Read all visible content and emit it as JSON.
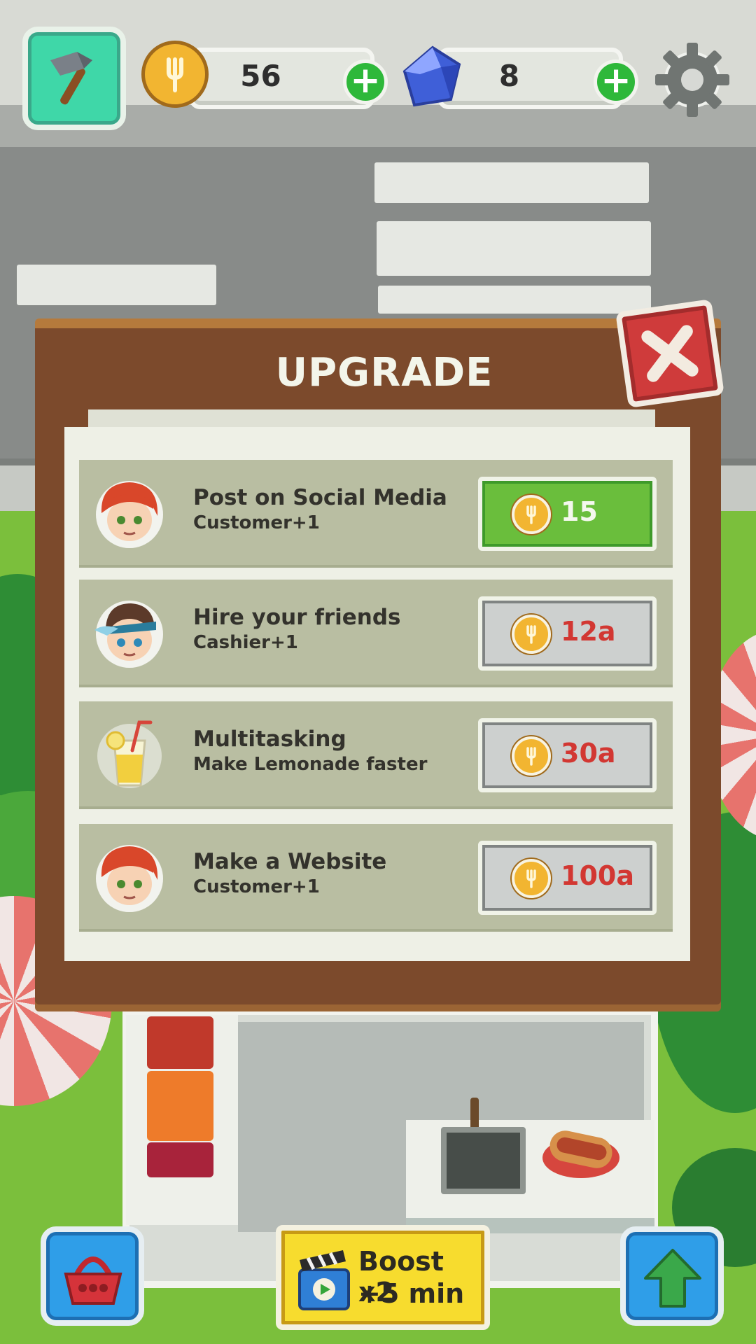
{
  "topbar": {
    "coins": "56",
    "gems": "8",
    "coin_plus": "+",
    "gem_plus": "+",
    "icons": [
      "hammer-icon",
      "coin-icon",
      "gem-icon",
      "plus-icon",
      "gear-icon"
    ]
  },
  "modal": {
    "title": "UPGRADE",
    "close_icon": "close-icon",
    "items": [
      {
        "icon": "redhead-avatar-icon",
        "title": "Post on Social Media",
        "subtitle": "Customer+1",
        "price": "15",
        "state": "affordable"
      },
      {
        "icon": "visor-avatar-icon",
        "title": "Hire your friends",
        "subtitle": "Cashier+1",
        "price": "12a",
        "state": "locked"
      },
      {
        "icon": "lemonade-icon",
        "title": "Multitasking",
        "subtitle": "Make Lemonade faster",
        "price": "30a",
        "state": "locked"
      },
      {
        "icon": "redhead-avatar-icon",
        "title": "Make a Website",
        "subtitle": "Customer+1",
        "price": "100a",
        "state": "locked"
      }
    ]
  },
  "bottombar": {
    "boost_line1": "Boost x2",
    "boost_line2": "+5 min",
    "icons": [
      "basket-icon",
      "video-clapper-icon",
      "up-arrow-icon"
    ]
  },
  "colors": {
    "board_brown": "#7c4a2c",
    "buy_green": "#6abe3c",
    "locked_price_red": "#d23732",
    "boost_yellow": "#f7dc2e",
    "button_blue": "#2f9ee8",
    "close_red": "#cf3b3b"
  }
}
